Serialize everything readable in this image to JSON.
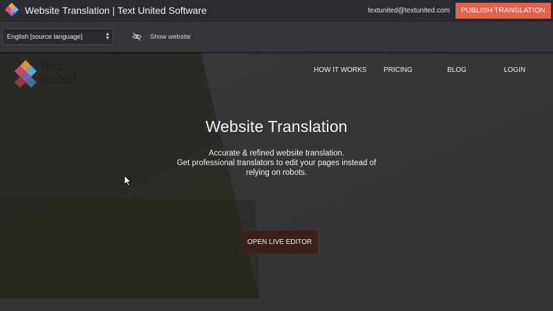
{
  "app": {
    "title": "Website Translation | Text United Software",
    "user_email": "textunited@textunited.com",
    "publish_label": "PUBLISH TRANSLATION"
  },
  "toolbar": {
    "language_select_value": "English [source language]",
    "show_website_label": "Show website",
    "visibility_icon": "eye-off-icon"
  },
  "site": {
    "logo_word_1": "text",
    "logo_word_2": "united",
    "nav": [
      "HOW IT WORKS",
      "PRICING",
      "BLOG",
      "LOGIN"
    ],
    "hero_title": "Website Translation",
    "hero_line_1": "Accurate & refined website translation.",
    "hero_line_2": "Get professional translators to edit your pages instead of relying on robots.",
    "cta_label": "OPEN LIVE EDITOR"
  },
  "colors": {
    "accent": "#e5624a",
    "topbar": "#2b2c30",
    "toolbar": "#35363a",
    "cta": "#3c2119"
  }
}
